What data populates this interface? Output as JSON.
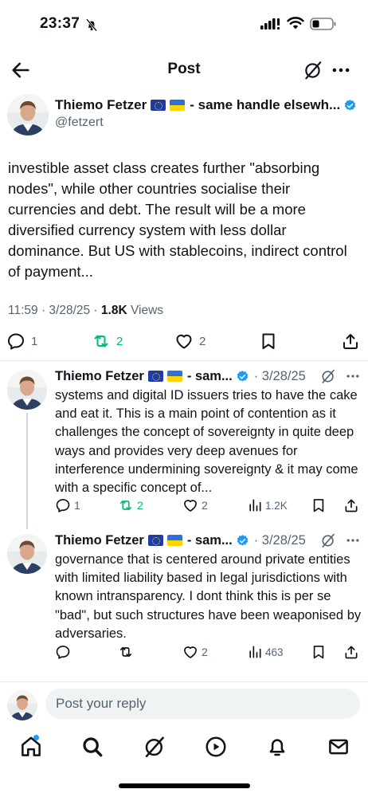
{
  "status_bar": {
    "time": "23:37"
  },
  "header": {
    "title": "Post"
  },
  "main_tweet": {
    "author_name": "Thiemo Fetzer",
    "author_suffix": "- same handle elsewh...",
    "handle": "@fetzert",
    "text": "investible asset class creates further \"absorbing nodes\", while other countries socialise their currencies and debt. The result will be a more diversified currency system with less dollar dominance. But US with stablecoins, indirect control of payment...",
    "timestamp": "11:59 · 3/28/25 · ",
    "views_count": "1.8K",
    "views_label": " Views",
    "replies": "1",
    "reposts": "2",
    "likes": "2"
  },
  "replies": [
    {
      "author_name": "Thiemo Fetzer",
      "author_suffix": "- sam...",
      "date": "· 3/28/25",
      "text": "systems and digital ID issuers tries to have the cake and eat it. This is a main point of contention as it challenges the concept of sovereignty in quite deep ways and provides very deep avenues for interference undermining sovereignty & it may come with a specific concept of...",
      "replies": "1",
      "reposts": "2",
      "likes": "2",
      "views": "1.2K"
    },
    {
      "author_name": "Thiemo Fetzer",
      "author_suffix": "- sam...",
      "date": "· 3/28/25",
      "text": "governance that is centered around private entities with limited liability based in legal jurisdictions with known intransparency. I dont think this is per se \"bad\", but such structures have been weaponised by adversaries.",
      "replies": "",
      "reposts": "",
      "likes": "2",
      "views": "463"
    }
  ],
  "composer": {
    "placeholder": "Post your reply"
  },
  "nav": [
    "home-icon",
    "search-icon",
    "grok-icon",
    "play-icon",
    "bell-icon",
    "mail-icon"
  ],
  "colors": {
    "accent": "#1d9bf0",
    "repost_active": "#00ba7c",
    "secondary_text": "#536471",
    "verified": "#1d9bf0"
  }
}
